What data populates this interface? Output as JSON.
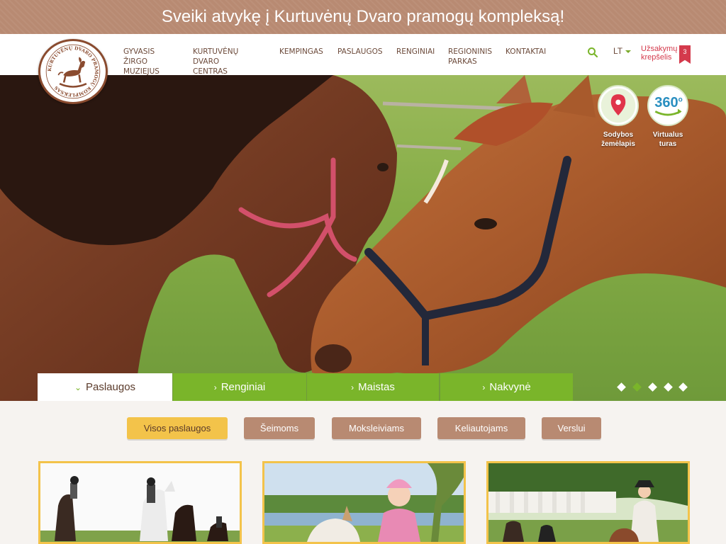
{
  "banner": {
    "greeting": "Sveiki atvykę į",
    "name": "Kurtuvėnų Dvaro pramogų kompleksą!"
  },
  "logo": {
    "text": "KURTUVĖNŲ DVARO PRAMOGŲ KOMPLEKSAS"
  },
  "nav": {
    "items": [
      {
        "line1": "GYVASIS ŽIRGO",
        "line2": "MUZIEJUS"
      },
      {
        "line1": "KURTUVĖNŲ DVARO",
        "line2": "CENTRAS"
      },
      {
        "line1": "KEMPINGAS",
        "line2": ""
      },
      {
        "line1": "PASLAUGOS",
        "line2": ""
      },
      {
        "line1": "RENGINIAI",
        "line2": ""
      },
      {
        "line1": "REGIONINIS",
        "line2": "PARKAS"
      },
      {
        "line1": "KONTAKTAI",
        "line2": ""
      }
    ]
  },
  "header": {
    "language": "LT",
    "cart_line1": "Užsakymų",
    "cart_line2": "krepšelis",
    "cart_count": "3"
  },
  "hero": {
    "map_label_1": "Sodybos",
    "map_label_2": "žemėlapis",
    "tour_label_1": "Virtualus",
    "tour_label_2": "turas",
    "tour_icon_text": "360",
    "tour_icon_sup": "o"
  },
  "tabs": [
    "Paslaugos",
    "Renginiai",
    "Maistas",
    "Nakvynė"
  ],
  "filters": [
    "Visos paslaugos",
    "Šeimoms",
    "Moksleiviams",
    "Keliautojams",
    "Verslui"
  ],
  "colors": {
    "brand_brown": "#b88a72",
    "accent_green": "#7ab52a",
    "accent_yellow": "#f3c34a",
    "cart_red": "#d43a4c"
  }
}
